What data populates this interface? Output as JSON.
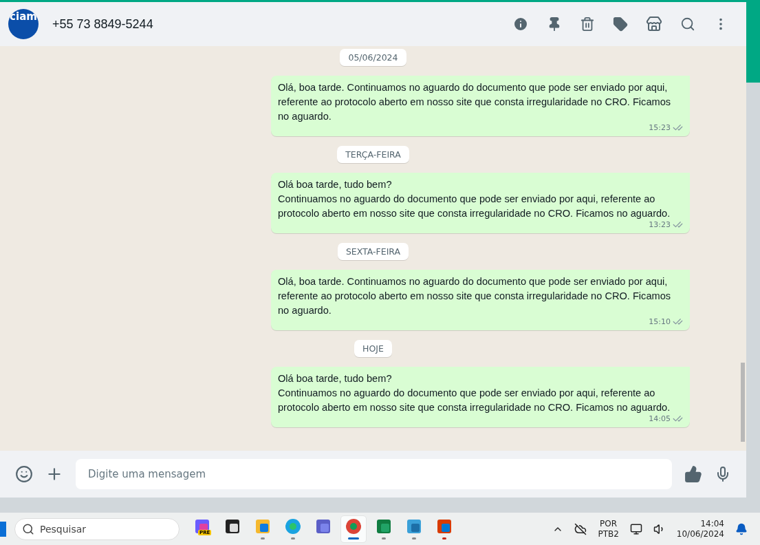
{
  "chat_header": {
    "avatar_text": "ciam",
    "contact": "+55 73 8849-5244"
  },
  "messages": [
    {
      "kind": "date",
      "text": "05/06/2024"
    },
    {
      "kind": "outgoing",
      "lines": [
        "Olá, boa tarde. Continuamos no aguardo do documento que pode ser enviado por aqui, referente ao protocolo aberto em nosso site que consta irregularidade no CRO. Ficamos no aguardo."
      ],
      "time": "15:23"
    },
    {
      "kind": "date",
      "text": "TERÇA-FEIRA"
    },
    {
      "kind": "outgoing",
      "lines": [
        "Olá boa tarde, tudo bem?",
        "Continuamos no aguardo do documento que pode ser enviado por aqui, referente ao protocolo aberto em nosso site que consta irregularidade no CRO. Ficamos no aguardo."
      ],
      "time": "13:23"
    },
    {
      "kind": "date",
      "text": "SEXTA-FEIRA"
    },
    {
      "kind": "outgoing",
      "lines": [
        "Olá, boa tarde. Continuamos no aguardo do documento que pode ser enviado por aqui, referente ao protocolo aberto em nosso site que consta irregularidade no CRO. Ficamos no aguardo."
      ],
      "time": "15:10"
    },
    {
      "kind": "date",
      "text": "HOJE"
    },
    {
      "kind": "outgoing",
      "lines": [
        "Olá boa tarde, tudo bem?",
        "Continuamos no aguardo do documento que pode ser enviado por aqui, referente ao protocolo aberto em nosso site que consta irregularidade no CRO. Ficamos no aguardo."
      ],
      "time": "14:05"
    }
  ],
  "composer": {
    "placeholder": "Digite uma mensagem"
  },
  "taskbar": {
    "search_placeholder": "Pesquisar",
    "apps": [
      {
        "kind": "copilot",
        "badge": "PRE",
        "running": false,
        "selected": false
      },
      {
        "kind": "taskview",
        "running": false,
        "selected": false
      },
      {
        "kind": "explorer",
        "running": true,
        "selected": false
      },
      {
        "kind": "edge",
        "running": true,
        "selected": false
      },
      {
        "kind": "teams",
        "running": false,
        "selected": false
      },
      {
        "kind": "chrome",
        "running": true,
        "selected": true
      },
      {
        "kind": "excel",
        "running": true,
        "selected": false
      },
      {
        "kind": "notepad",
        "running": true,
        "selected": false
      },
      {
        "kind": "snipping",
        "running": true,
        "selected": false
      }
    ],
    "language": [
      "POR",
      "PTB2"
    ],
    "time": "14:04",
    "date": "10/06/2024"
  }
}
